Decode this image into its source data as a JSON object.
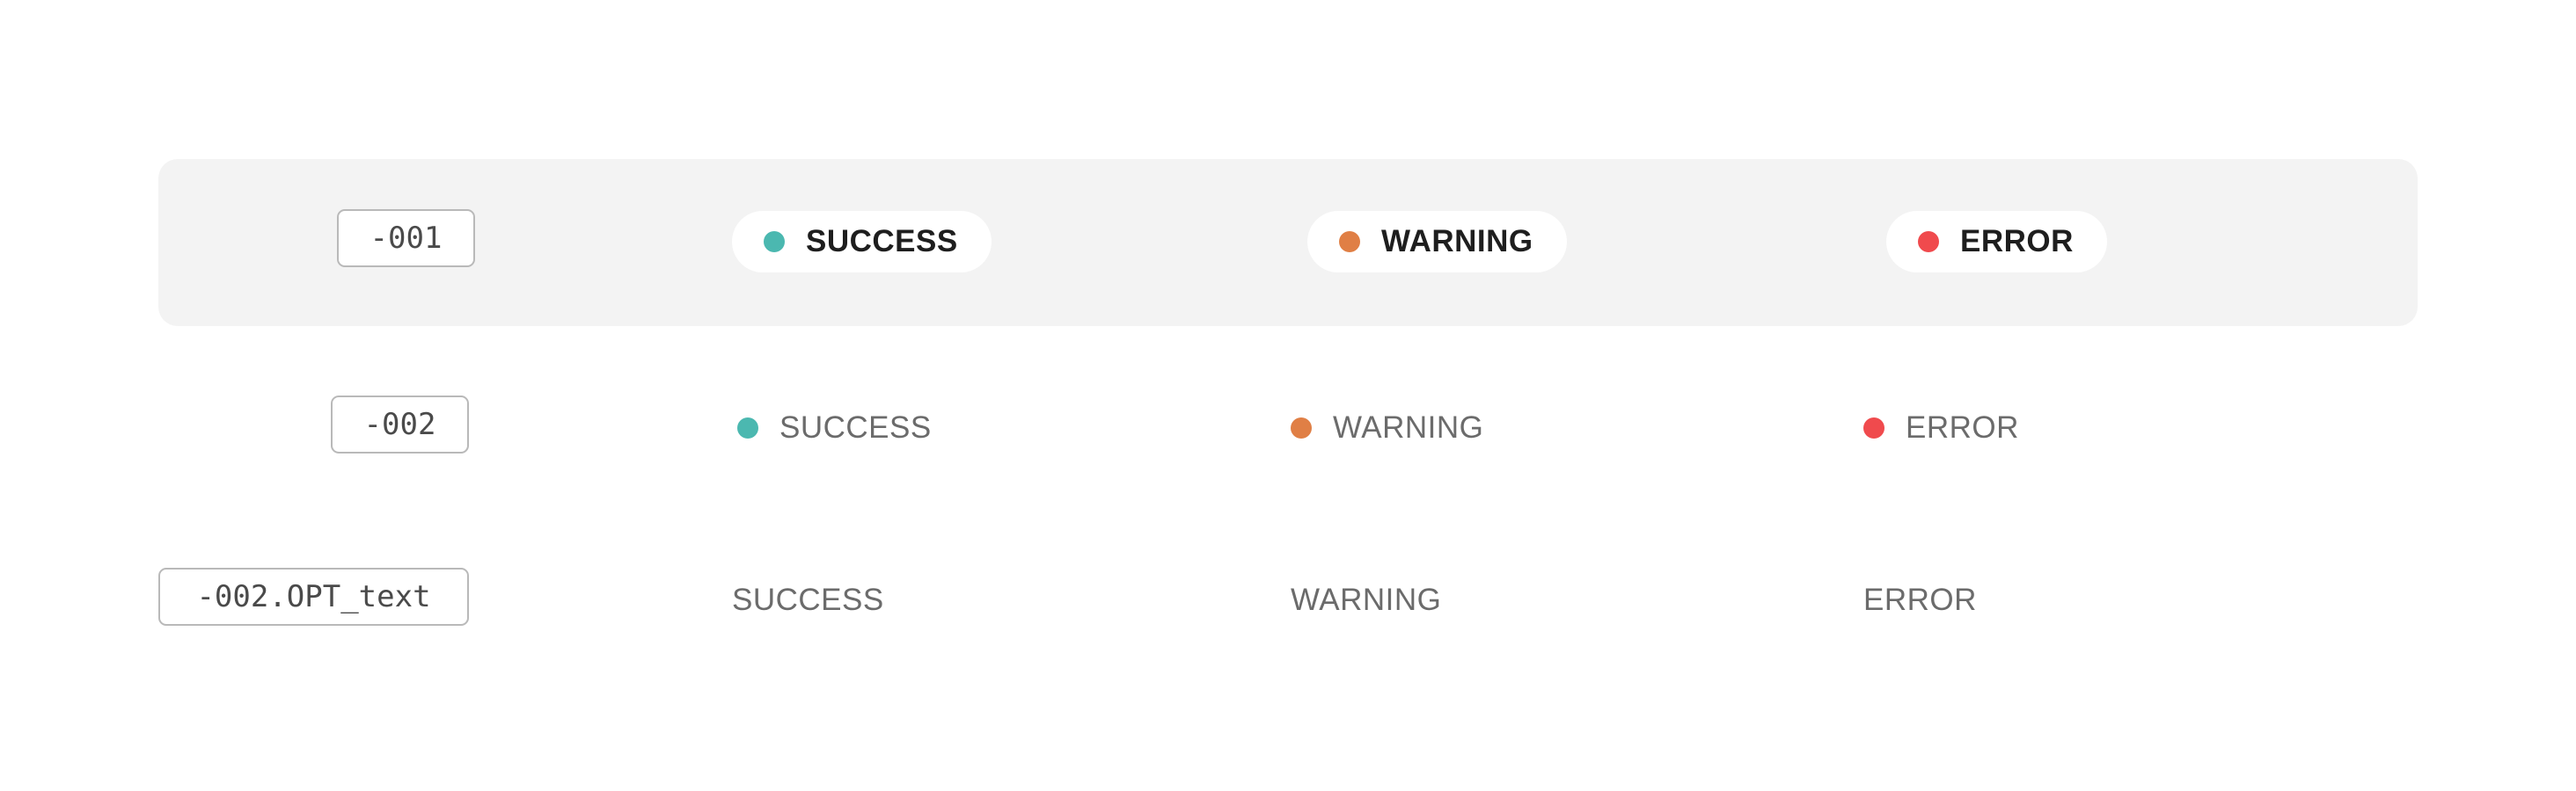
{
  "variants": [
    {
      "code": "-001",
      "style": "pill",
      "items": [
        {
          "label": "SUCCESS",
          "status": "success",
          "color": "#4bb8b0"
        },
        {
          "label": "WARNING",
          "status": "warning",
          "color": "#e07f45"
        },
        {
          "label": "ERROR",
          "status": "error",
          "color": "#f04a4d"
        }
      ]
    },
    {
      "code": "-002",
      "style": "dot-text",
      "items": [
        {
          "label": "SUCCESS",
          "status": "success",
          "color": "#4bb8b0"
        },
        {
          "label": "WARNING",
          "status": "warning",
          "color": "#e07f45"
        },
        {
          "label": "ERROR",
          "status": "error",
          "color": "#f04a4d"
        }
      ]
    },
    {
      "code": "-002.OPT_text",
      "style": "text",
      "items": [
        {
          "label": "SUCCESS",
          "status": "success"
        },
        {
          "label": "WARNING",
          "status": "warning"
        },
        {
          "label": "ERROR",
          "status": "error"
        }
      ]
    }
  ],
  "colors": {
    "panel_background": "#f3f3f3",
    "pill_background": "#ffffff",
    "code_border": "#b9b9b9",
    "muted_text": "#6b6b6b",
    "strong_text": "#1e1e1e"
  }
}
